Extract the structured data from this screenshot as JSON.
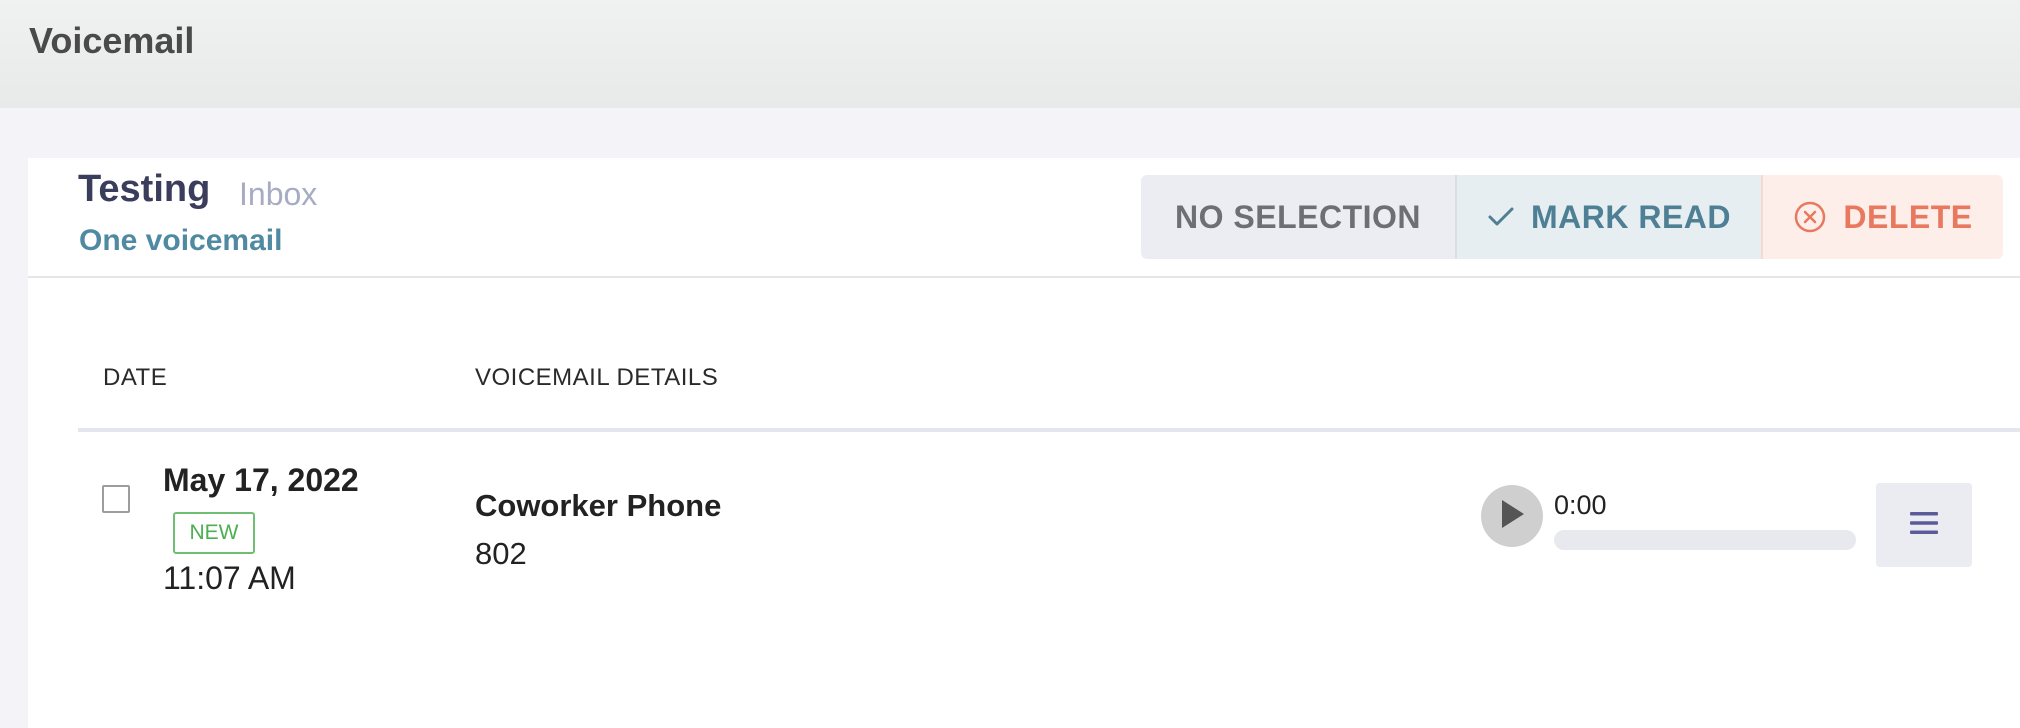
{
  "page": {
    "title": "Voicemail"
  },
  "mailbox": {
    "name": "Testing",
    "folder": "Inbox",
    "count_text": "One voicemail"
  },
  "actions": {
    "no_selection": "NO SELECTION",
    "mark_read": "MARK READ",
    "delete": "DELETE"
  },
  "table": {
    "columns": [
      "DATE",
      "VOICEMAIL DETAILS"
    ],
    "rows": [
      {
        "date": "May 17, 2022",
        "badge": "NEW",
        "time": "11:07 AM",
        "caller": "Coworker Phone",
        "extension": "802",
        "audio_time": "0:00"
      }
    ]
  },
  "icons": {
    "mark_read": "check-icon",
    "delete": "circle-x-icon",
    "play": "play-icon",
    "menu": "hamburger-menu-icon"
  },
  "colors": {
    "accent_teal": "#4f8aa2",
    "delete_red": "#e8785e",
    "new_badge_green": "#4caf50",
    "menu_purple": "#5b5b9a"
  }
}
